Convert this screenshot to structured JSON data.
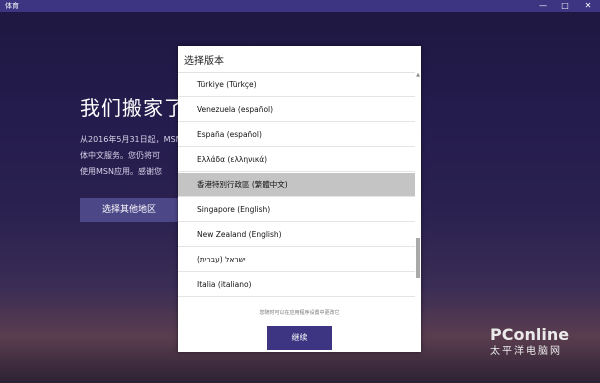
{
  "window": {
    "title": "体育",
    "minimize": "—",
    "maximize": "□",
    "close": "✕"
  },
  "background": {
    "heading": "我们搬家了",
    "paragraph_lines": [
      "从2016年5月31日起，MSN",
      "体中文服务。您仍将可",
      "使用MSN应用。感谢您"
    ],
    "button_label": "选择其他地区"
  },
  "dialog": {
    "title": "选择版本",
    "items": [
      {
        "label": "Türkiye (Türkçe)",
        "selected": false
      },
      {
        "label": "Venezuela (español)",
        "selected": false
      },
      {
        "label": "España (español)",
        "selected": false
      },
      {
        "label": "Ελλάδα (ελληνικά)",
        "selected": false
      },
      {
        "label": "香港特別行政區 (繁體中文)",
        "selected": true
      },
      {
        "label": "Singapore (English)",
        "selected": false
      },
      {
        "label": "New Zealand (English)",
        "selected": false
      },
      {
        "label": "ישראל (עברית)",
        "selected": false
      },
      {
        "label": "Italia (italiano)",
        "selected": false
      }
    ],
    "note": "您随时可以在应用程序设置中更改它",
    "continue_label": "继续"
  },
  "watermark": {
    "logo": "PConline",
    "sub": "太平洋电脑网"
  }
}
